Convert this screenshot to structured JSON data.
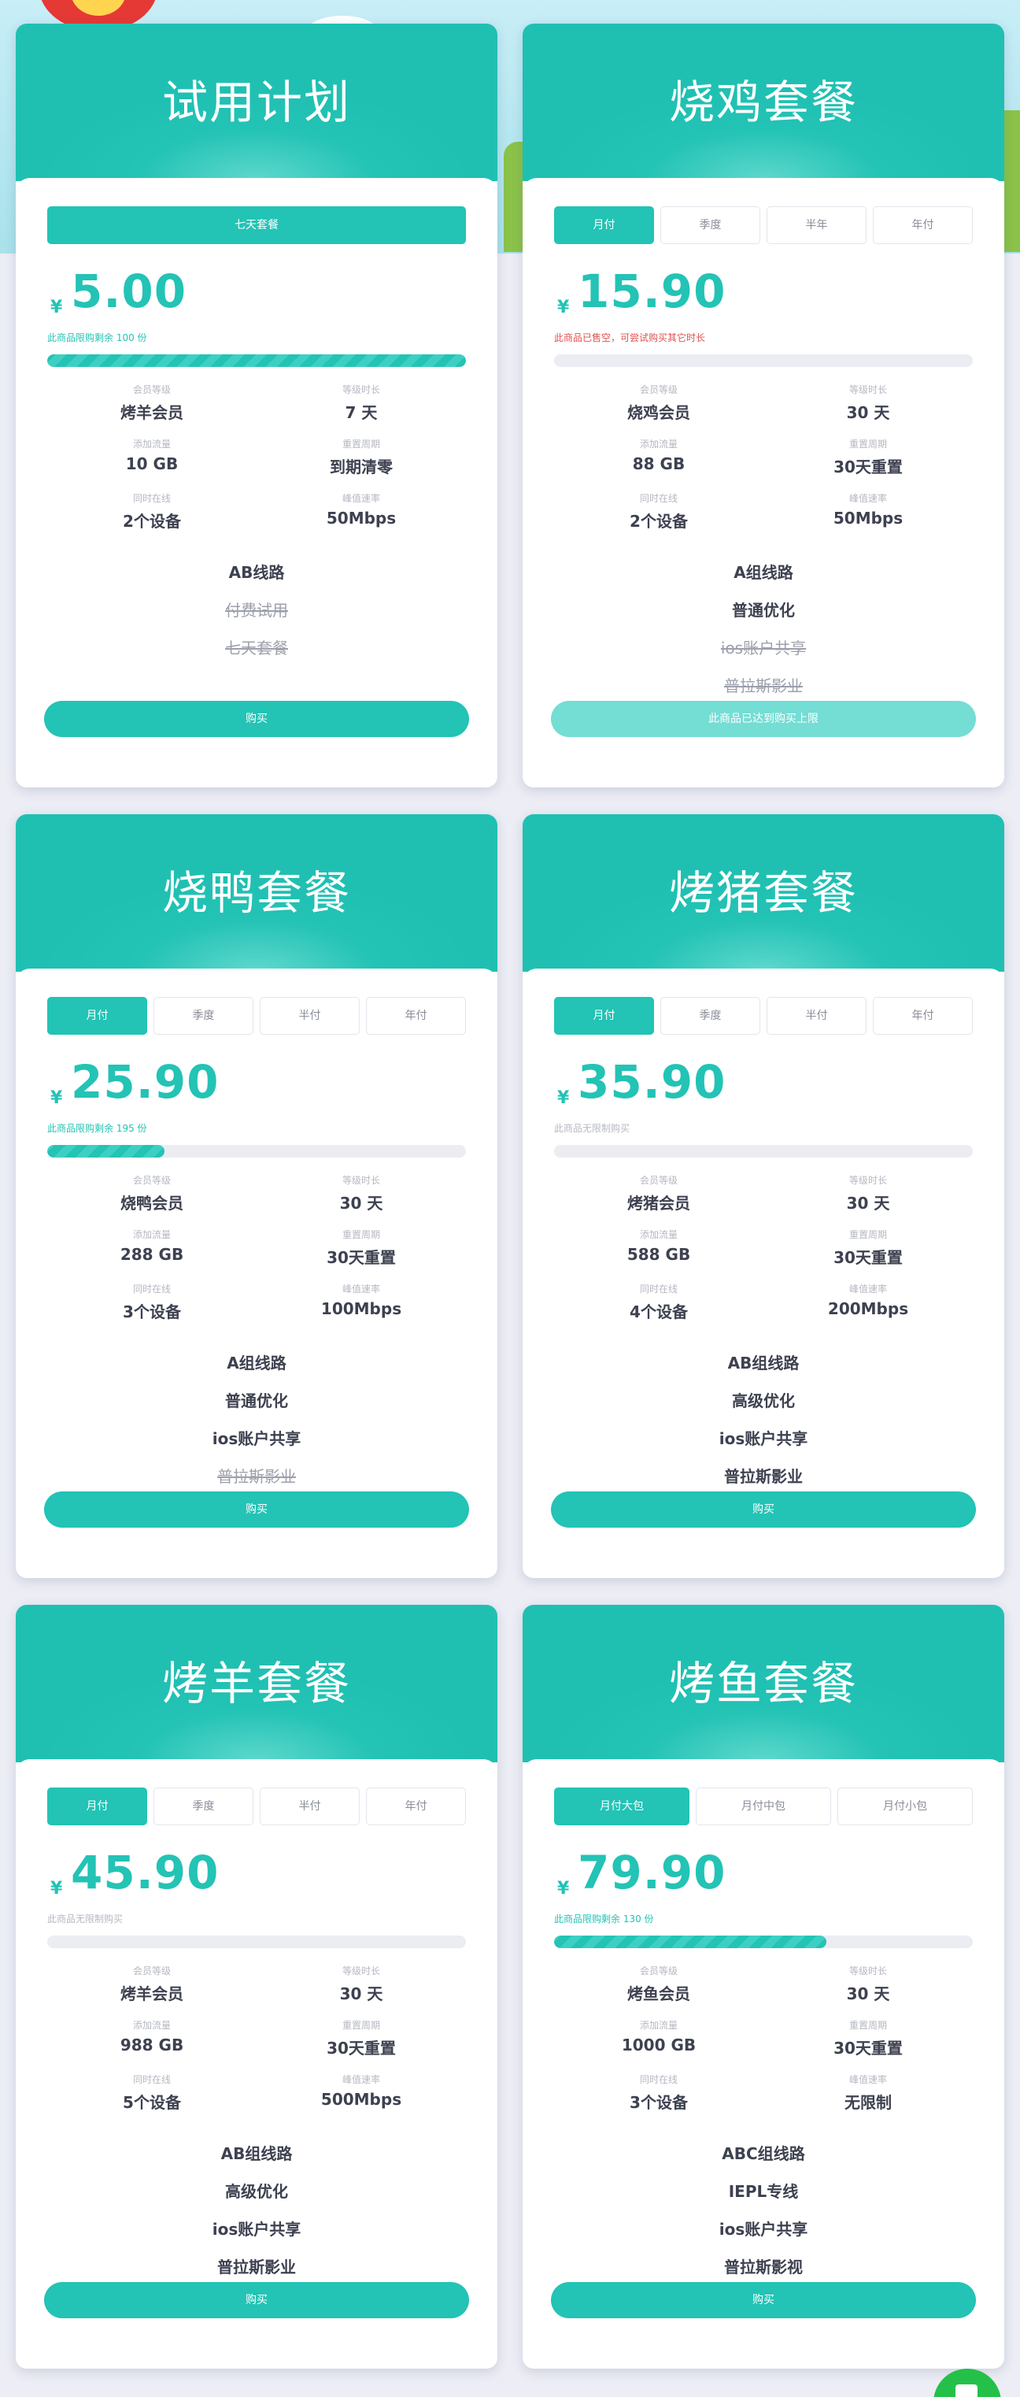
{
  "plans": [
    {
      "title": "试用计划",
      "tabs": [
        {
          "label": "七天套餐",
          "active": true
        }
      ],
      "currency": "¥",
      "price": "5.00",
      "note": "此商品限购剩余 100 份",
      "note_style": "teal",
      "progress": 1.0,
      "specs": [
        {
          "label": "会员等级",
          "value": "烤羊会员"
        },
        {
          "label": "等级时长",
          "value": "7 天"
        },
        {
          "label": "添加流量",
          "value": "10 GB"
        },
        {
          "label": "重置周期",
          "value": "到期清零"
        },
        {
          "label": "同时在线",
          "value": "2个设备"
        },
        {
          "label": "峰值速率",
          "value": "50Mbps"
        }
      ],
      "features": [
        {
          "text": "AB线路",
          "off": false
        },
        {
          "text": "付费试用",
          "off": true
        },
        {
          "text": "七天套餐",
          "off": true
        }
      ],
      "button": "购买",
      "button_disabled": false
    },
    {
      "title": "烧鸡套餐",
      "tabs": [
        {
          "label": "月付",
          "active": true
        },
        {
          "label": "季度",
          "active": false
        },
        {
          "label": "半年",
          "active": false
        },
        {
          "label": "年付",
          "active": false
        }
      ],
      "currency": "¥",
      "price": "15.90",
      "note": "此商品已售空，可尝试购买其它时长",
      "note_style": "red",
      "progress": 0,
      "specs": [
        {
          "label": "会员等级",
          "value": "烧鸡会员"
        },
        {
          "label": "等级时长",
          "value": "30 天"
        },
        {
          "label": "添加流量",
          "value": "88 GB"
        },
        {
          "label": "重置周期",
          "value": "30天重置"
        },
        {
          "label": "同时在线",
          "value": "2个设备"
        },
        {
          "label": "峰值速率",
          "value": "50Mbps"
        }
      ],
      "features": [
        {
          "text": "A组线路",
          "off": false
        },
        {
          "text": "普通优化",
          "off": false
        },
        {
          "text": "ios账户共享",
          "off": true
        },
        {
          "text": "普拉斯影业",
          "off": true
        }
      ],
      "button": "此商品已达到购买上限",
      "button_disabled": true
    },
    {
      "title": "烧鸭套餐",
      "tabs": [
        {
          "label": "月付",
          "active": true
        },
        {
          "label": "季度",
          "active": false
        },
        {
          "label": "半付",
          "active": false
        },
        {
          "label": "年付",
          "active": false
        }
      ],
      "currency": "¥",
      "price": "25.90",
      "note": "此商品限购剩余 195 份",
      "note_style": "teal",
      "progress": 0.28,
      "specs": [
        {
          "label": "会员等级",
          "value": "烧鸭会员"
        },
        {
          "label": "等级时长",
          "value": "30 天"
        },
        {
          "label": "添加流量",
          "value": "288 GB"
        },
        {
          "label": "重置周期",
          "value": "30天重置"
        },
        {
          "label": "同时在线",
          "value": "3个设备"
        },
        {
          "label": "峰值速率",
          "value": "100Mbps"
        }
      ],
      "features": [
        {
          "text": "A组线路",
          "off": false
        },
        {
          "text": "普通优化",
          "off": false
        },
        {
          "text": "ios账户共享",
          "off": false
        },
        {
          "text": "普拉斯影业",
          "off": true
        }
      ],
      "button": "购买",
      "button_disabled": false
    },
    {
      "title": "烤猪套餐",
      "tabs": [
        {
          "label": "月付",
          "active": true
        },
        {
          "label": "季度",
          "active": false
        },
        {
          "label": "半付",
          "active": false
        },
        {
          "label": "年付",
          "active": false
        }
      ],
      "currency": "¥",
      "price": "35.90",
      "note": "此商品无限制购买",
      "note_style": "gray",
      "progress": 0,
      "specs": [
        {
          "label": "会员等级",
          "value": "烤猪会员"
        },
        {
          "label": "等级时长",
          "value": "30 天"
        },
        {
          "label": "添加流量",
          "value": "588 GB"
        },
        {
          "label": "重置周期",
          "value": "30天重置"
        },
        {
          "label": "同时在线",
          "value": "4个设备"
        },
        {
          "label": "峰值速率",
          "value": "200Mbps"
        }
      ],
      "features": [
        {
          "text": "AB组线路",
          "off": false
        },
        {
          "text": "高级优化",
          "off": false
        },
        {
          "text": "ios账户共享",
          "off": false
        },
        {
          "text": "普拉斯影业",
          "off": false
        }
      ],
      "button": "购买",
      "button_disabled": false
    },
    {
      "title": "烤羊套餐",
      "tabs": [
        {
          "label": "月付",
          "active": true
        },
        {
          "label": "季度",
          "active": false
        },
        {
          "label": "半付",
          "active": false
        },
        {
          "label": "年付",
          "active": false
        }
      ],
      "currency": "¥",
      "price": "45.90",
      "note": "此商品无限制购买",
      "note_style": "gray",
      "progress": 0,
      "specs": [
        {
          "label": "会员等级",
          "value": "烤羊会员"
        },
        {
          "label": "等级时长",
          "value": "30 天"
        },
        {
          "label": "添加流量",
          "value": "988 GB"
        },
        {
          "label": "重置周期",
          "value": "30天重置"
        },
        {
          "label": "同时在线",
          "value": "5个设备"
        },
        {
          "label": "峰值速率",
          "value": "500Mbps"
        }
      ],
      "features": [
        {
          "text": "AB组线路",
          "off": false
        },
        {
          "text": "高级优化",
          "off": false
        },
        {
          "text": "ios账户共享",
          "off": false
        },
        {
          "text": "普拉斯影业",
          "off": false
        }
      ],
      "button": "购买",
      "button_disabled": false
    },
    {
      "title": "烤鱼套餐",
      "tabs": [
        {
          "label": "月付大包",
          "active": true
        },
        {
          "label": "月付中包",
          "active": false
        },
        {
          "label": "月付小包",
          "active": false
        }
      ],
      "currency": "¥",
      "price": "79.90",
      "note": "此商品限购剩余 130 份",
      "note_style": "teal",
      "progress": 0.65,
      "specs": [
        {
          "label": "会员等级",
          "value": "烤鱼会员"
        },
        {
          "label": "等级时长",
          "value": "30 天"
        },
        {
          "label": "添加流量",
          "value": "1000 GB"
        },
        {
          "label": "重置周期",
          "value": "30天重置"
        },
        {
          "label": "同时在线",
          "value": "3个设备"
        },
        {
          "label": "峰值速率",
          "value": "无限制"
        }
      ],
      "features": [
        {
          "text": "ABC组线路",
          "off": false
        },
        {
          "text": "IEPL专线",
          "off": false
        },
        {
          "text": "ios账户共享",
          "off": false
        },
        {
          "text": "普拉斯影视",
          "off": false
        }
      ],
      "button": "购买",
      "button_disabled": false
    }
  ],
  "colors": {
    "accent": "#23c3b5",
    "warning": "#e0524f"
  },
  "icons": {
    "chat": "chat-bubble-icon"
  }
}
